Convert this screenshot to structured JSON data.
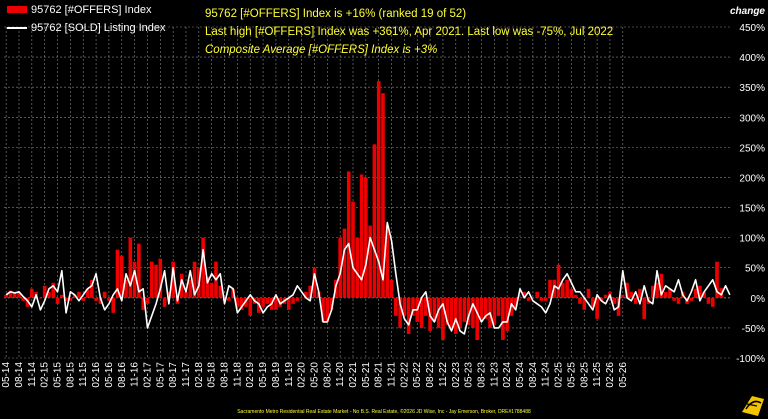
{
  "header": {
    "line1": "95762 [#OFFERS] Index is +16% (ranked 19 of 52)",
    "line2": "Last high [#OFFERS] Index was +361%, Apr 2021. Last low was -75%, Jul 2022",
    "line3": "Composite Average [#OFFERS] Index is +3%"
  },
  "footer": "Sacramento Metro Residential Real Estate Market - No B.S. Real Estate, ©2026 JD Wise, Inc - Jay Emerson, Broker, DRE#1788488",
  "colors": {
    "bar": "#ee0000",
    "line": "#ffffff",
    "grid": "#8a8a8a",
    "accent": "#ffff33",
    "background": "#000000",
    "logo": "#f5c400"
  },
  "logo_icon": "swoosh-logo-icon",
  "chart_data": {
    "type": "bar",
    "ylabel": "change",
    "ylim": [
      -100,
      450
    ],
    "yticks": [
      "450%",
      "400%",
      "350%",
      "300%",
      "250%",
      "200%",
      "150%",
      "100%",
      "50%",
      "0%",
      "-50%",
      "-100%"
    ],
    "ytick_values": [
      450,
      400,
      350,
      300,
      250,
      200,
      150,
      100,
      50,
      0,
      -50,
      -100
    ],
    "legend_position": "top-left",
    "x_start": "2014-05",
    "xtick_labels": [
      "05-14",
      "08-14",
      "11-14",
      "02-15",
      "05-15",
      "08-15",
      "11-15",
      "02-16",
      "05-16",
      "08-16",
      "11-16",
      "02-17",
      "05-17",
      "08-17",
      "11-17",
      "02-18",
      "05-18",
      "08-18",
      "11-18",
      "02-19",
      "05-19",
      "08-19",
      "11-19",
      "02-20",
      "05-20",
      "08-20",
      "11-20",
      "02-21",
      "05-21",
      "08-21",
      "11-21",
      "02-22",
      "05-22",
      "08-22",
      "11-22",
      "02-23",
      "05-23",
      "08-23",
      "11-23",
      "02-24",
      "05-24",
      "08-24",
      "11-24",
      "02-25",
      "05-25",
      "08-25",
      "11-25",
      "02-26",
      "05-26"
    ],
    "series": [
      {
        "name": "95762 [#OFFERS] Index",
        "kind": "bar",
        "values": [
          5,
          12,
          10,
          8,
          -5,
          -15,
          15,
          10,
          0,
          20,
          10,
          25,
          -10,
          5,
          -5,
          -5,
          5,
          10,
          -5,
          15,
          30,
          -5,
          -10,
          10,
          -5,
          -25,
          80,
          70,
          30,
          100,
          60,
          90,
          -20,
          -10,
          60,
          55,
          65,
          -15,
          10,
          60,
          -10,
          40,
          10,
          30,
          60,
          50,
          100,
          35,
          25,
          60,
          20,
          -5,
          -5,
          15,
          -15,
          -20,
          -15,
          -30,
          -10,
          -25,
          -15,
          -10,
          -20,
          -20,
          -15,
          -10,
          -20,
          -10,
          -5,
          0,
          10,
          20,
          50,
          10,
          -40,
          -40,
          -20,
          30,
          100,
          115,
          210,
          160,
          100,
          205,
          200,
          120,
          255,
          360,
          340,
          120,
          30,
          -30,
          -50,
          -30,
          -60,
          -30,
          -40,
          -50,
          -30,
          -55,
          -40,
          -50,
          -70,
          -45,
          -50,
          -60,
          -50,
          -40,
          -45,
          -50,
          -70,
          -40,
          -35,
          -50,
          -45,
          -30,
          -70,
          -55,
          -30,
          -15,
          0,
          10,
          -5,
          0,
          10,
          -5,
          -5,
          30,
          30,
          55,
          25,
          30,
          15,
          5,
          -10,
          -20,
          15,
          -15,
          -35,
          -5,
          5,
          10,
          -10,
          -30,
          5,
          25,
          10,
          -10,
          15,
          -35,
          -10,
          20,
          25,
          40,
          10,
          15,
          -5,
          -10,
          10,
          -10,
          -5,
          15,
          20,
          10,
          -10,
          -15,
          60,
          16
        ]
      },
      {
        "name": "95762 [SOLD] Listing Index",
        "kind": "line",
        "values": [
          5,
          10,
          8,
          10,
          2,
          -5,
          -15,
          5,
          -20,
          -5,
          15,
          20,
          10,
          45,
          -25,
          10,
          5,
          -5,
          5,
          15,
          20,
          40,
          0,
          -20,
          -10,
          5,
          15,
          -5,
          40,
          20,
          45,
          10,
          15,
          -50,
          -30,
          -10,
          15,
          45,
          -10,
          50,
          -5,
          30,
          10,
          45,
          5,
          20,
          80,
          25,
          40,
          30,
          40,
          -10,
          20,
          15,
          -25,
          -15,
          -5,
          5,
          -5,
          -10,
          -25,
          -15,
          -10,
          5,
          -10,
          -5,
          0,
          5,
          20,
          10,
          0,
          -5,
          40,
          10,
          -40,
          -40,
          -20,
          20,
          40,
          80,
          90,
          50,
          40,
          30,
          55,
          100,
          80,
          60,
          30,
          125,
          95,
          40,
          -10,
          -35,
          -45,
          -20,
          -20,
          0,
          10,
          -30,
          -40,
          -20,
          -10,
          -40,
          -55,
          -35,
          -55,
          -60,
          -30,
          -10,
          -25,
          -40,
          -30,
          -25,
          -50,
          -50,
          -40,
          -40,
          -10,
          -20,
          15,
          0,
          10,
          -5,
          -10,
          -15,
          -25,
          -10,
          20,
          15,
          30,
          40,
          25,
          10,
          10,
          0,
          -10,
          -20,
          5,
          -5,
          -10,
          5,
          -20,
          -15,
          45,
          0,
          -5,
          10,
          -10,
          20,
          -5,
          -10,
          45,
          5,
          20,
          15,
          10,
          30,
          5,
          -5,
          10,
          30,
          -5,
          10,
          20,
          30,
          10,
          5,
          20,
          5
        ]
      }
    ]
  }
}
